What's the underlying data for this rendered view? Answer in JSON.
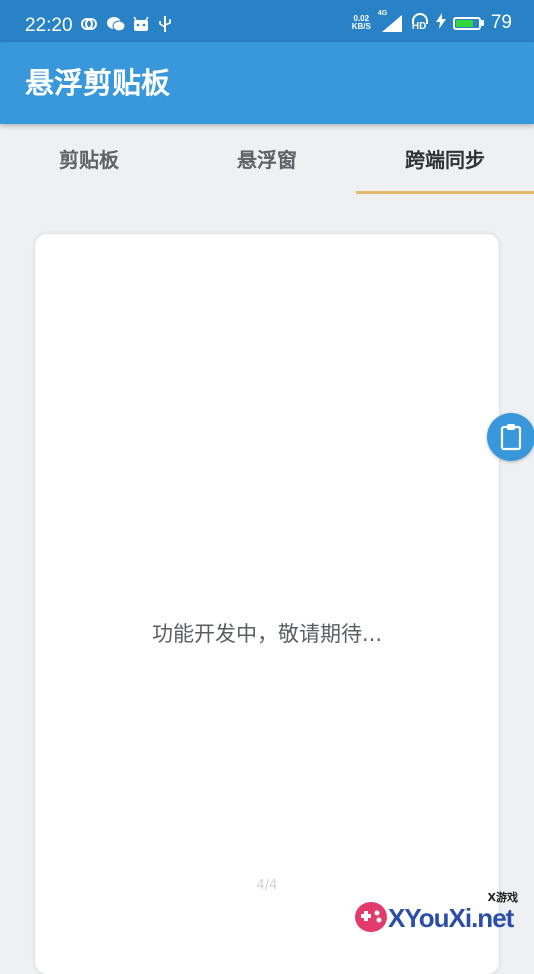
{
  "status_bar": {
    "time": "22:20",
    "net_speed_value": "0.02",
    "net_speed_unit": "KB/S",
    "network_type": "4G",
    "hd_label": "HD",
    "battery_percent": "79",
    "battery_level": 0.79,
    "battery_color": "#32d53a"
  },
  "app_bar": {
    "title": "悬浮剪贴板",
    "color": "#3997dc"
  },
  "tabs": [
    {
      "label": "剪贴板",
      "active": false
    },
    {
      "label": "悬浮窗",
      "active": false
    },
    {
      "label": "跨端同步",
      "active": true
    }
  ],
  "tab_indicator_color": "#e6b76a",
  "card": {
    "message": "功能开发中，敬请期待...",
    "page_indicator": "4/4"
  },
  "float_button": {
    "icon": "clipboard-icon"
  },
  "watermark": {
    "small_text": "X游戏",
    "text": "XYouXi.net"
  }
}
